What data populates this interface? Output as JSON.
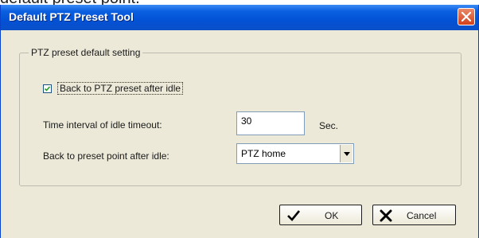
{
  "background": {
    "caption": "default preset point."
  },
  "dialog": {
    "title": "Default PTZ Preset Tool",
    "group_title": "PTZ preset default setting",
    "back_to_preset": {
      "label": "Back to PTZ preset after idle",
      "checked": true
    },
    "idle_timeout": {
      "label": "Time interval of idle timeout:",
      "value": "30",
      "unit": "Sec."
    },
    "preset_point": {
      "label": "Back to preset point after idle:",
      "selected": "PTZ home"
    },
    "buttons": {
      "ok": "OK",
      "cancel": "Cancel"
    }
  },
  "colors": {
    "titlebar": "#0a5fe0",
    "dialog_bg": "#ece9d8",
    "close_button": "#d2401a"
  },
  "icons": {
    "close": "close-icon",
    "check": "checkmark-icon",
    "dropdown": "chevron-down-icon",
    "ok": "checkmark-icon",
    "cancel": "x-icon"
  }
}
